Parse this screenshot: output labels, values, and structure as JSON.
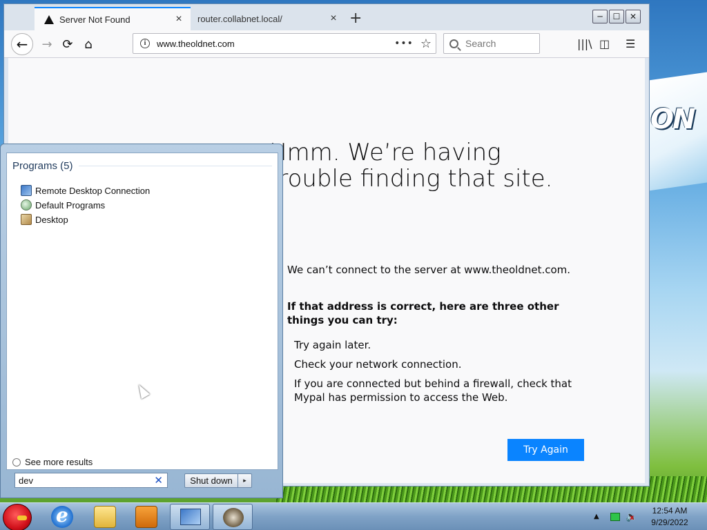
{
  "browser": {
    "tabs": [
      {
        "title": "Server Not Found",
        "active": true
      },
      {
        "title": "router.collabnet.local/",
        "active": false
      }
    ],
    "new_tab_glyph": "+",
    "close_glyph": "×",
    "window_buttons": [
      "─",
      "☐",
      "✕"
    ],
    "nav": {
      "back": "←",
      "forward": "→",
      "reload": "⟳",
      "home": "⌂"
    },
    "url": "www.theoldnet.com",
    "url_info_glyph": "i",
    "url_more_glyph": "•••",
    "bookmark_glyph": "☆",
    "search_placeholder": "Search",
    "tools": {
      "library": "|||\\",
      "sidebar": "◫",
      "menu": "☰"
    }
  },
  "error_page": {
    "title_line1": "Hmm. We’re having",
    "title_line2": "trouble finding that site.",
    "description": "We can’t connect to the server at www.theoldnet.com.",
    "advice": "If that address is correct, here are three other things you can try:",
    "suggestions": [
      "Try again later.",
      "Check your network connection.",
      "If you are connected but behind a firewall, check that Mypal has permission to access the Web."
    ],
    "button_label": "Try Again",
    "accent": "#0a84ff"
  },
  "start_menu": {
    "section_header": "Programs (5)",
    "programs": [
      {
        "label": "Remote Desktop Connection",
        "icon": "remote-desktop-icon"
      },
      {
        "label": "Default Programs",
        "icon": "default-programs-icon"
      },
      {
        "label": "Desktop",
        "icon": "desktop-icon"
      }
    ],
    "see_more": "See more results",
    "search_value": "dev",
    "clear_glyph": "✕",
    "shutdown_label": "Shut down",
    "shutdown_arrow": "▸"
  },
  "taskbar": {
    "apps": [
      "start-orb-icon",
      "internet-explorer-icon",
      "folder-icon",
      "media-player-icon",
      "remote-desktop-icon",
      "mypal-browser-icon"
    ],
    "tray_up_glyph": "▲",
    "volume_glyph": "🔈",
    "mute_glyph": "x",
    "time": "12:54 AM",
    "date": "9/29/2022"
  }
}
